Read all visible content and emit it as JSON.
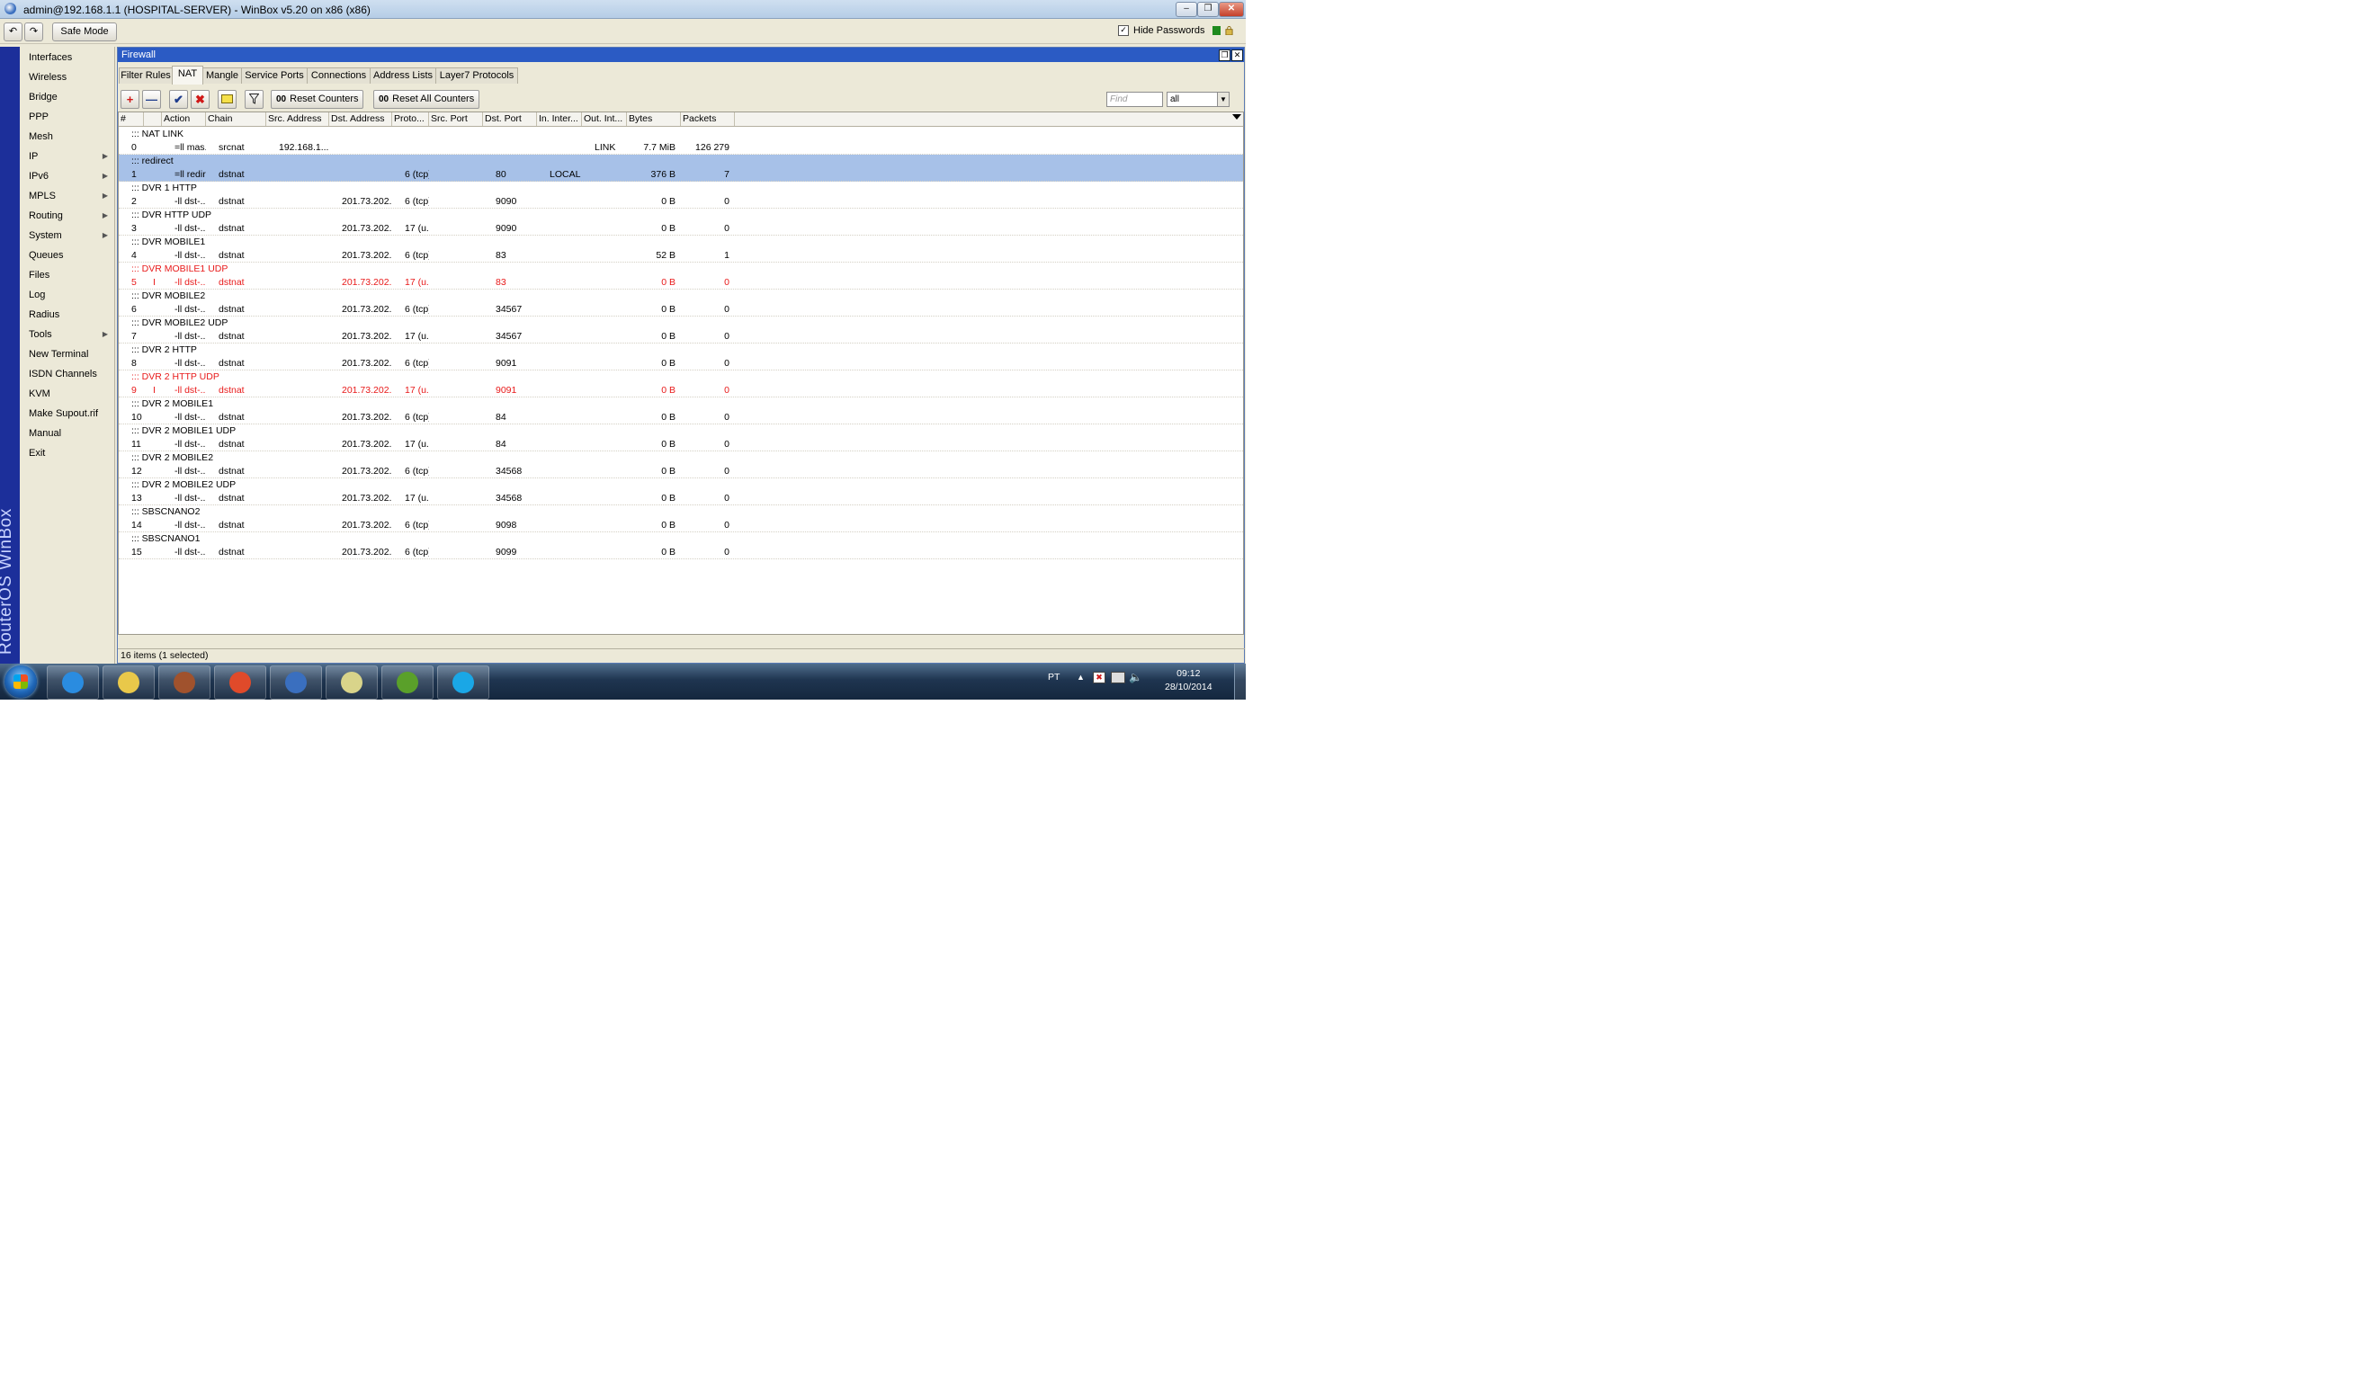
{
  "window": {
    "title": "admin@192.168.1.1 (HOSPITAL-SERVER) - WinBox v5.20 on x86 (x86)",
    "brand": "RouterOS WinBox"
  },
  "toolbar": {
    "safe_mode_label": "Safe Mode",
    "hide_passwords_label": "Hide Passwords",
    "hide_passwords_checked": true
  },
  "menu": {
    "items": [
      {
        "label": "Interfaces",
        "submenu": false
      },
      {
        "label": "Wireless",
        "submenu": false
      },
      {
        "label": "Bridge",
        "submenu": false
      },
      {
        "label": "PPP",
        "submenu": false
      },
      {
        "label": "Mesh",
        "submenu": false
      },
      {
        "label": "IP",
        "submenu": true
      },
      {
        "label": "IPv6",
        "submenu": true
      },
      {
        "label": "MPLS",
        "submenu": true
      },
      {
        "label": "Routing",
        "submenu": true
      },
      {
        "label": "System",
        "submenu": true
      },
      {
        "label": "Queues",
        "submenu": false
      },
      {
        "label": "Files",
        "submenu": false
      },
      {
        "label": "Log",
        "submenu": false
      },
      {
        "label": "Radius",
        "submenu": false
      },
      {
        "label": "Tools",
        "submenu": true
      },
      {
        "label": "New Terminal",
        "submenu": false
      },
      {
        "label": "ISDN Channels",
        "submenu": false
      },
      {
        "label": "KVM",
        "submenu": false
      },
      {
        "label": "Make Supout.rif",
        "submenu": false
      },
      {
        "label": "Manual",
        "submenu": false
      },
      {
        "label": "Exit",
        "submenu": false
      }
    ]
  },
  "firewall": {
    "title": "Firewall",
    "tabs": [
      "Filter Rules",
      "NAT",
      "Mangle",
      "Service Ports",
      "Connections",
      "Address Lists",
      "Layer7 Protocols"
    ],
    "active_tab": "NAT",
    "actions": {
      "reset_counters": "Reset Counters",
      "reset_all_counters": "Reset All Counters",
      "find_placeholder": "Find",
      "filter_value": "all"
    },
    "columns": [
      "#",
      "",
      "Action",
      "Chain",
      "Src. Address",
      "Dst. Address",
      "Proto...",
      "Src. Port",
      "Dst. Port",
      "In. Inter...",
      "Out. Int...",
      "Bytes",
      "Packets"
    ],
    "rules": [
      {
        "comment": "::: NAT LINK",
        "num": "0",
        "flag": "",
        "action": "=ll mas...",
        "chain": "srcnat",
        "src": "192.168.1....",
        "dst": "",
        "proto": "",
        "sport": "",
        "dport": "",
        "in": "",
        "out": "LINK",
        "bytes": "7.7 MiB",
        "packets": "126 279",
        "selected": false,
        "disabled": false
      },
      {
        "comment": "::: redirect",
        "num": "1",
        "flag": "",
        "action": "=ll redir...",
        "chain": "dstnat",
        "src": "",
        "dst": "",
        "proto": "6 (tcp)",
        "sport": "",
        "dport": "80",
        "in": "LOCAL",
        "out": "",
        "bytes": "376 B",
        "packets": "7",
        "selected": true,
        "disabled": false
      },
      {
        "comment": "::: DVR 1 HTTP",
        "num": "2",
        "flag": "",
        "action": "-ll dst-...",
        "chain": "dstnat",
        "src": "",
        "dst": "201.73.202...",
        "proto": "6 (tcp)",
        "sport": "",
        "dport": "9090",
        "in": "",
        "out": "",
        "bytes": "0 B",
        "packets": "0",
        "selected": false,
        "disabled": false
      },
      {
        "comment": "::: DVR HTTP UDP",
        "num": "3",
        "flag": "",
        "action": "-ll dst-...",
        "chain": "dstnat",
        "src": "",
        "dst": "201.73.202...",
        "proto": "17 (u...",
        "sport": "",
        "dport": "9090",
        "in": "",
        "out": "",
        "bytes": "0 B",
        "packets": "0",
        "selected": false,
        "disabled": false
      },
      {
        "comment": "::: DVR MOBILE1",
        "num": "4",
        "flag": "",
        "action": "-ll dst-...",
        "chain": "dstnat",
        "src": "",
        "dst": "201.73.202...",
        "proto": "6 (tcp)",
        "sport": "",
        "dport": "83",
        "in": "",
        "out": "",
        "bytes": "52 B",
        "packets": "1",
        "selected": false,
        "disabled": false
      },
      {
        "comment": "::: DVR MOBILE1 UDP",
        "num": "5",
        "flag": "I",
        "action": "-ll dst-...",
        "chain": "dstnat",
        "src": "",
        "dst": "201.73.202...",
        "proto": "17 (u...",
        "sport": "",
        "dport": "83",
        "in": "",
        "out": "",
        "bytes": "0 B",
        "packets": "0",
        "selected": false,
        "disabled": true
      },
      {
        "comment": "::: DVR MOBILE2",
        "num": "6",
        "flag": "",
        "action": "-ll dst-...",
        "chain": "dstnat",
        "src": "",
        "dst": "201.73.202...",
        "proto": "6 (tcp)",
        "sport": "",
        "dport": "34567",
        "in": "",
        "out": "",
        "bytes": "0 B",
        "packets": "0",
        "selected": false,
        "disabled": false
      },
      {
        "comment": "::: DVR MOBILE2 UDP",
        "num": "7",
        "flag": "",
        "action": "-ll dst-...",
        "chain": "dstnat",
        "src": "",
        "dst": "201.73.202...",
        "proto": "17 (u...",
        "sport": "",
        "dport": "34567",
        "in": "",
        "out": "",
        "bytes": "0 B",
        "packets": "0",
        "selected": false,
        "disabled": false
      },
      {
        "comment": "::: DVR 2 HTTP",
        "num": "8",
        "flag": "",
        "action": "-ll dst-...",
        "chain": "dstnat",
        "src": "",
        "dst": "201.73.202...",
        "proto": "6 (tcp)",
        "sport": "",
        "dport": "9091",
        "in": "",
        "out": "",
        "bytes": "0 B",
        "packets": "0",
        "selected": false,
        "disabled": false
      },
      {
        "comment": "::: DVR 2 HTTP UDP",
        "num": "9",
        "flag": "I",
        "action": "-ll dst-...",
        "chain": "dstnat",
        "src": "",
        "dst": "201.73.202...",
        "proto": "17 (u...",
        "sport": "",
        "dport": "9091",
        "in": "",
        "out": "",
        "bytes": "0 B",
        "packets": "0",
        "selected": false,
        "disabled": true
      },
      {
        "comment": "::: DVR 2 MOBILE1",
        "num": "10",
        "flag": "",
        "action": "-ll dst-...",
        "chain": "dstnat",
        "src": "",
        "dst": "201.73.202...",
        "proto": "6 (tcp)",
        "sport": "",
        "dport": "84",
        "in": "",
        "out": "",
        "bytes": "0 B",
        "packets": "0",
        "selected": false,
        "disabled": false
      },
      {
        "comment": "::: DVR 2 MOBILE1 UDP",
        "num": "11",
        "flag": "",
        "action": "-ll dst-...",
        "chain": "dstnat",
        "src": "",
        "dst": "201.73.202...",
        "proto": "17 (u...",
        "sport": "",
        "dport": "84",
        "in": "",
        "out": "",
        "bytes": "0 B",
        "packets": "0",
        "selected": false,
        "disabled": false
      },
      {
        "comment": "::: DVR 2 MOBILE2",
        "num": "12",
        "flag": "",
        "action": "-ll dst-...",
        "chain": "dstnat",
        "src": "",
        "dst": "201.73.202...",
        "proto": "6 (tcp)",
        "sport": "",
        "dport": "34568",
        "in": "",
        "out": "",
        "bytes": "0 B",
        "packets": "0",
        "selected": false,
        "disabled": false
      },
      {
        "comment": "::: DVR 2 MOBILE2 UDP",
        "num": "13",
        "flag": "",
        "action": "-ll dst-...",
        "chain": "dstnat",
        "src": "",
        "dst": "201.73.202...",
        "proto": "17 (u...",
        "sport": "",
        "dport": "34568",
        "in": "",
        "out": "",
        "bytes": "0 B",
        "packets": "0",
        "selected": false,
        "disabled": false
      },
      {
        "comment": "::: SBSCNANO2",
        "num": "14",
        "flag": "",
        "action": "-ll dst-...",
        "chain": "dstnat",
        "src": "",
        "dst": "201.73.202...",
        "proto": "6 (tcp)",
        "sport": "",
        "dport": "9098",
        "in": "",
        "out": "",
        "bytes": "0 B",
        "packets": "0",
        "selected": false,
        "disabled": false
      },
      {
        "comment": "::: SBSCNANO1",
        "num": "15",
        "flag": "",
        "action": "-ll dst-...",
        "chain": "dstnat",
        "src": "",
        "dst": "201.73.202...",
        "proto": "6 (tcp)",
        "sport": "",
        "dport": "9099",
        "in": "",
        "out": "",
        "bytes": "0 B",
        "packets": "0",
        "selected": false,
        "disabled": false
      }
    ],
    "status": "16 items (1 selected)"
  },
  "taskbar": {
    "apps": [
      "internet-explorer-icon",
      "file-explorer-icon",
      "gimp-icon",
      "chrome-icon",
      "teamviewer-icon",
      "folder-icon",
      "utorrent-icon",
      "skype-icon"
    ],
    "language": "PT",
    "time": "09:12",
    "date": "28/10/2014"
  },
  "colors": {
    "brand_strip": "#1c2f9a",
    "selection": "#a7c1e8",
    "disabled_text": "#e81a1a",
    "inner_title": "#2b5bc4"
  }
}
